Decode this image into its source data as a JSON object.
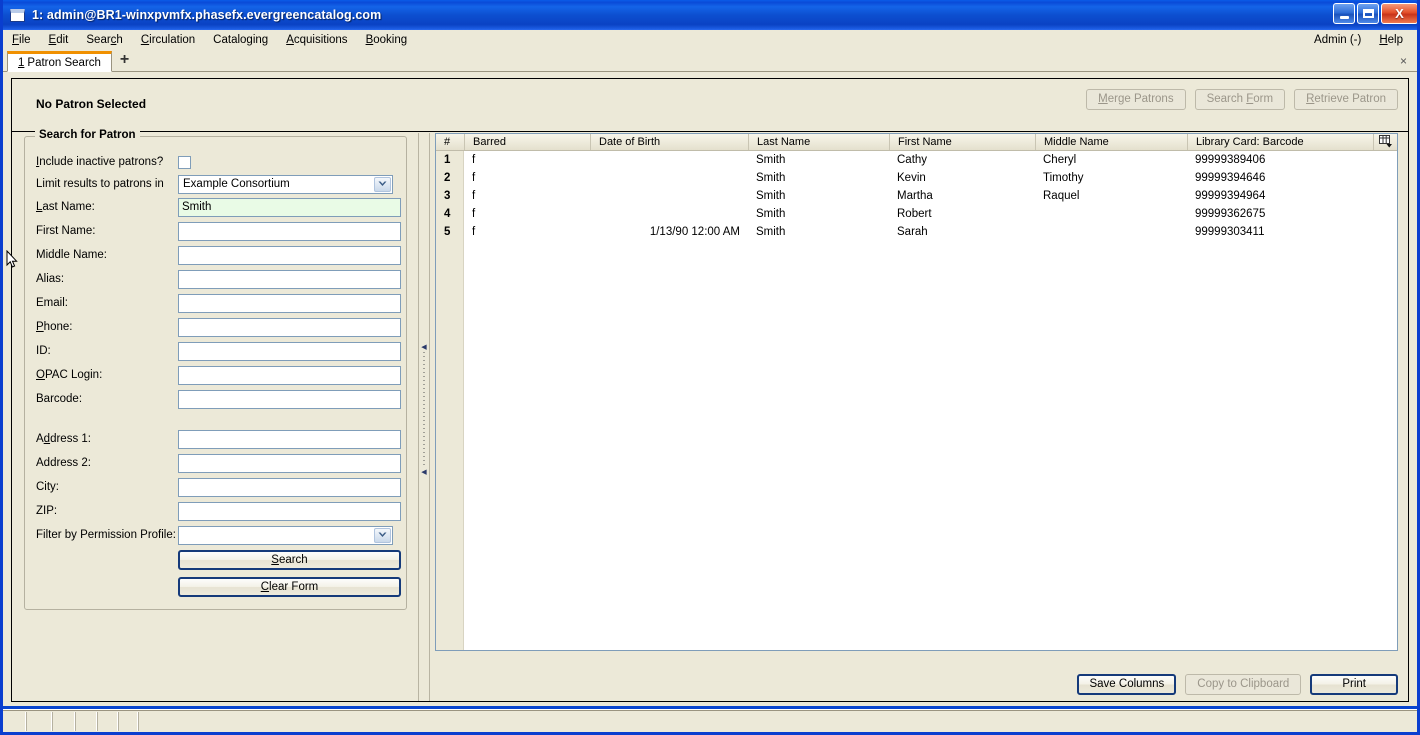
{
  "window": {
    "title": "1: admin@BR1-winxpvmfx.phasefx.evergreencatalog.com",
    "icon": "window-icon",
    "minimize_label": "Minimize",
    "maximize_label": "Maximize",
    "close_label": "X"
  },
  "menubar": {
    "items": [
      {
        "label": "File",
        "accel": "F"
      },
      {
        "label": "Edit",
        "accel": "E"
      },
      {
        "label": "Search",
        "accel": "c"
      },
      {
        "label": "Circulation",
        "accel": "C"
      },
      {
        "label": "Cataloging",
        "accel": "g"
      },
      {
        "label": "Acquisitions",
        "accel": "A"
      },
      {
        "label": "Booking",
        "accel": "B"
      }
    ],
    "right_items": [
      {
        "label": "Admin (-)"
      },
      {
        "label": "Help"
      }
    ]
  },
  "tabs": {
    "active": {
      "index": "1",
      "label": "Patron Search"
    },
    "add_label": "+",
    "close_label": "×"
  },
  "patron_header": {
    "title": "No Patron Selected",
    "buttons": [
      {
        "label": "Merge Patrons",
        "disabled": true
      },
      {
        "label": "Search Form",
        "disabled": true
      },
      {
        "label": "Retrieve Patron",
        "disabled": true
      }
    ]
  },
  "search_form": {
    "legend": "Search for Patron",
    "include_inactive": {
      "label": "Include inactive patrons?",
      "checked": false
    },
    "limit_results": {
      "label": "Limit results to patrons in",
      "value": "Example Consortium"
    },
    "fields": [
      {
        "label": "Last Name:",
        "value": "Smith",
        "focused": true
      },
      {
        "label": "First Name:",
        "value": "",
        "focused": false
      },
      {
        "label": "Middle Name:",
        "value": "",
        "focused": false
      },
      {
        "label": "Alias:",
        "value": "",
        "focused": false
      },
      {
        "label": "Email:",
        "value": "",
        "focused": false
      },
      {
        "label": "Phone:",
        "value": "",
        "focused": false
      },
      {
        "label": "ID:",
        "value": "",
        "focused": false
      },
      {
        "label": "OPAC Login:",
        "value": "",
        "focused": false
      },
      {
        "label": "Barcode:",
        "value": "",
        "focused": false
      }
    ],
    "address_fields": [
      {
        "label": "Address 1:",
        "value": ""
      },
      {
        "label": "Address 2:",
        "value": ""
      },
      {
        "label": "City:",
        "value": ""
      },
      {
        "label": "ZIP:",
        "value": ""
      }
    ],
    "permission_profile": {
      "label": "Filter by Permission Profile:",
      "value": ""
    },
    "search_button": "Search",
    "clear_button": "Clear Form"
  },
  "results": {
    "columns": [
      "#",
      "Barred",
      "Date of Birth",
      "Last Name",
      "First Name",
      "Middle Name",
      "Library Card: Barcode"
    ],
    "column_picker_icon": "column-picker-icon",
    "rows": [
      {
        "num": "1",
        "barred": "f",
        "dob": "",
        "last": "Smith",
        "first": "Cathy",
        "middle": "Cheryl",
        "card": "99999389406"
      },
      {
        "num": "2",
        "barred": "f",
        "dob": "",
        "last": "Smith",
        "first": "Kevin",
        "middle": "Timothy",
        "card": "99999394646"
      },
      {
        "num": "3",
        "barred": "f",
        "dob": "",
        "last": "Smith",
        "first": "Martha",
        "middle": "Raquel",
        "card": "99999394964"
      },
      {
        "num": "4",
        "barred": "f",
        "dob": "",
        "last": "Smith",
        "first": "Robert",
        "middle": "",
        "card": "99999362675"
      },
      {
        "num": "5",
        "barred": "f",
        "dob": "1/13/90 12:00 AM",
        "last": "Smith",
        "first": "Sarah",
        "middle": "",
        "card": "99999303411"
      }
    ],
    "footer_buttons": [
      {
        "label": "Save Columns",
        "disabled": false,
        "default": true
      },
      {
        "label": "Copy to Clipboard",
        "disabled": true,
        "default": false
      },
      {
        "label": "Print",
        "disabled": false,
        "default": true
      }
    ]
  },
  "statusbar": {
    "cells": [
      "",
      "",
      "",
      "",
      "",
      "",
      ""
    ]
  },
  "colors": {
    "chrome": "#ece9d8",
    "title_blue": "#0a4ad8",
    "tab_accent": "#f09000",
    "field_border": "#7f9db9",
    "focus_green": "#e9fbe6"
  }
}
